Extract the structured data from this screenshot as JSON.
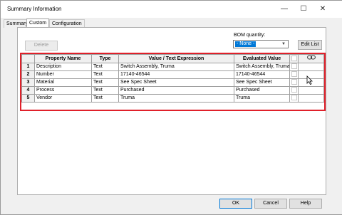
{
  "window": {
    "title": "Summary Information",
    "minimize": "—",
    "maximize": "☐",
    "close": "✕"
  },
  "tabs": [
    {
      "label": "Summary"
    },
    {
      "label": "Custom"
    },
    {
      "label": "Configuration Specific"
    }
  ],
  "toolbar": {
    "delete_label": "Delete",
    "bom_label": "BOM quantity:",
    "bom_value": "- None -",
    "edit_list_label": "Edit List"
  },
  "table": {
    "headers": [
      "",
      "Property Name",
      "Type",
      "Value / Text Expression",
      "Evaluated Value",
      "",
      ""
    ],
    "rows": [
      {
        "num": "1",
        "name": "Description",
        "type": "Text",
        "value": "Switch Assembly, Truma",
        "evaluated": "Switch Assembly, Truma"
      },
      {
        "num": "2",
        "name": "Number",
        "type": "Text",
        "value": "17140-46544",
        "evaluated": "17140-46544"
      },
      {
        "num": "3",
        "name": "Material",
        "type": "Text",
        "value": "See Spec Sheet",
        "evaluated": "See Spec Sheet"
      },
      {
        "num": "4",
        "name": "Process",
        "type": "Text",
        "value": "Purchased",
        "evaluated": "Purchased"
      },
      {
        "num": "5",
        "name": "Vendor",
        "type": "Text",
        "value": "Truma",
        "evaluated": "Truma"
      }
    ]
  },
  "footer": {
    "ok_label": "OK",
    "cancel_label": "Cancel",
    "help_label": "Help"
  },
  "colors": {
    "highlight_border": "#e0202a",
    "accent": "#0078d7"
  }
}
